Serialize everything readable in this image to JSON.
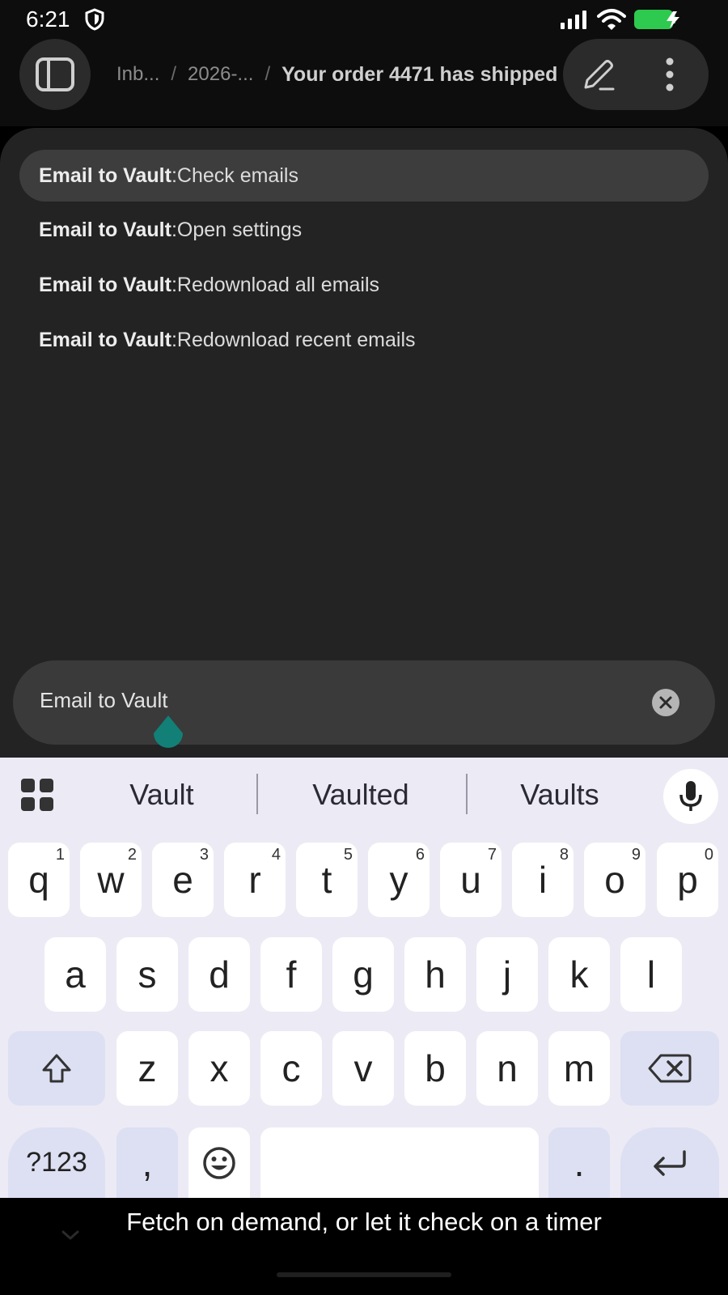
{
  "status_bar": {
    "time": "6:21",
    "icons": [
      "shield-icon",
      "signal-icon",
      "wifi-icon",
      "battery-charging-icon"
    ]
  },
  "breadcrumb": {
    "items": [
      "Inb...",
      "2026-..."
    ],
    "separator": "/",
    "current": "Your order 4471 has shipped"
  },
  "app_bar": {
    "icons": [
      "sidebar-toggle-icon",
      "edit-icon",
      "more-vert-icon"
    ]
  },
  "commands": [
    {
      "plugin": "Email to Vault",
      "sep": ": ",
      "action": "Check emails",
      "highlighted": true
    },
    {
      "plugin": "Email to Vault",
      "sep": ": ",
      "action": "Open settings",
      "highlighted": false
    },
    {
      "plugin": "Email to Vault",
      "sep": ": ",
      "action": "Redownload all emails",
      "highlighted": false
    },
    {
      "plugin": "Email to Vault",
      "sep": ": ",
      "action": "Redownload recent emails",
      "highlighted": false
    }
  ],
  "search": {
    "value": "Email to Vault"
  },
  "keyboard": {
    "suggestions": [
      "Vault",
      "Vaulted",
      "Vaults"
    ],
    "row1": [
      "q",
      "w",
      "e",
      "r",
      "t",
      "y",
      "u",
      "i",
      "o",
      "p"
    ],
    "row1_hints": [
      "1",
      "2",
      "3",
      "4",
      "5",
      "6",
      "7",
      "8",
      "9",
      "0"
    ],
    "row2": [
      "a",
      "s",
      "d",
      "f",
      "g",
      "h",
      "j",
      "k",
      "l"
    ],
    "row3": [
      "z",
      "x",
      "c",
      "v",
      "b",
      "n",
      "m"
    ],
    "symbols_label": "?123",
    "comma": ",",
    "period": "."
  },
  "caption": "Fetch on demand, or let it check on a timer",
  "colors": {
    "accent_handle": "#128077",
    "highlight_row": "#3d3d3d",
    "battery": "#2ec94f"
  }
}
